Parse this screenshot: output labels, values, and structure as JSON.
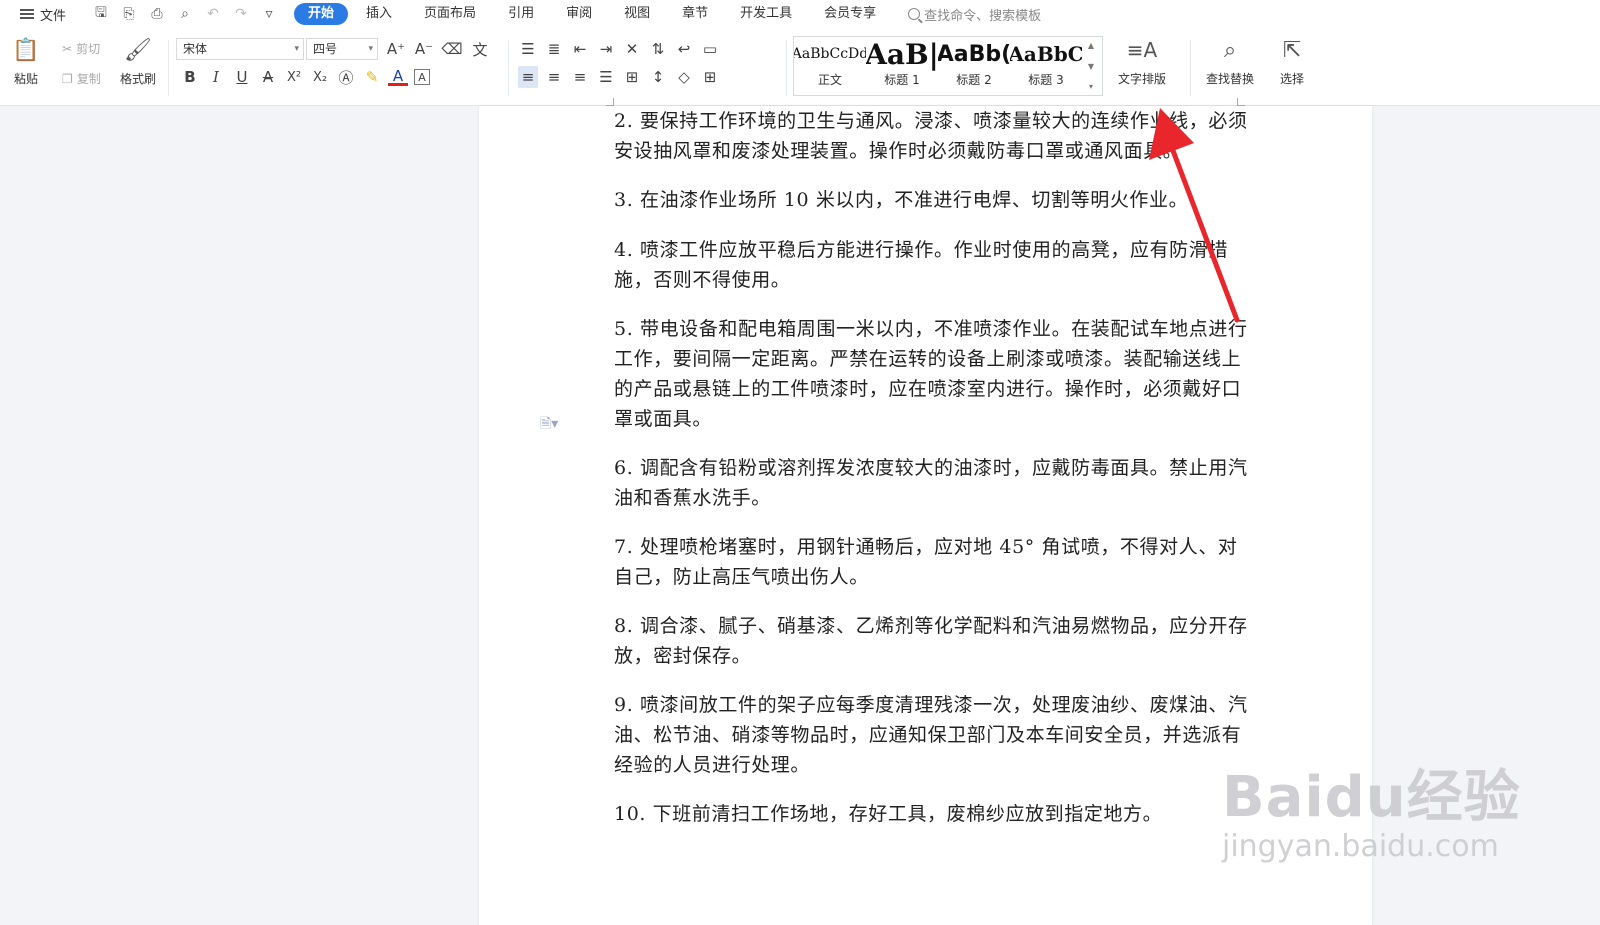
{
  "menubar": {
    "file_label": "文件",
    "tabs": [
      {
        "label": "开始",
        "active": true
      },
      {
        "label": "插入"
      },
      {
        "label": "页面布局"
      },
      {
        "label": "引用"
      },
      {
        "label": "审阅"
      },
      {
        "label": "视图"
      },
      {
        "label": "章节"
      },
      {
        "label": "开发工具"
      },
      {
        "label": "会员专享"
      }
    ],
    "search_placeholder": "查找命令、搜索模板"
  },
  "ribbon": {
    "paste": "粘贴",
    "cut": "剪切",
    "copy": "复制",
    "format_painter": "格式刷",
    "font_name": "宋体",
    "font_size": "四号",
    "styles": [
      {
        "preview": "AaBbCcDd",
        "name": "正文"
      },
      {
        "preview": "AaB|",
        "name": "标题 1"
      },
      {
        "preview": "AaBb(",
        "name": "标题 2"
      },
      {
        "preview": "AaBbC",
        "name": "标题 3"
      }
    ],
    "text_layout": "文字排版",
    "find_replace": "查找替换",
    "select": "选择"
  },
  "document": {
    "paragraphs": [
      "2. 要保持工作环境的卫生与通风。浸漆、喷漆量较大的连续作业线，必须安设抽风罩和废漆处理装置。操作时必须戴防毒口罩或通风面具。",
      "3. 在油漆作业场所 10 米以内，不准进行电焊、切割等明火作业。",
      "4. 喷漆工件应放平稳后方能进行操作。作业时使用的高凳，应有防滑措施，否则不得使用。",
      "5. 带电设备和配电箱周围一米以内，不准喷漆作业。在装配试车地点进行工作，要间隔一定距离。严禁在运转的设备上刷漆或喷漆。装配输送线上的产品或悬链上的工件喷漆时，应在喷漆室内进行。操作时，必须戴好口罩或面具。",
      "6. 调配含有铅粉或溶剂挥发浓度较大的油漆时，应戴防毒面具。禁止用汽油和香蕉水洗手。",
      "7. 处理喷枪堵塞时，用钢针通畅后，应对地 45° 角试喷，不得对人、对自己，防止高压气喷出伤人。",
      "8. 调合漆、腻子、硝基漆、乙烯剂等化学配料和汽油易燃物品，应分开存放，密封保存。",
      "9. 喷漆间放工件的架子应每季度清理残漆一次，处理废油纱、废煤油、汽油、松节油、硝漆等物品时，应通知保卫部门及本车间安全员，并选派有经验的人员进行处理。",
      "10. 下班前清扫工作场地，存好工具，废棉纱应放到指定地方。"
    ]
  },
  "watermark": {
    "brand": "Baidu经验",
    "url": "jingyan.baidu.com"
  },
  "colors": {
    "accent": "#2b7be4",
    "arrow": "#e8262b"
  }
}
